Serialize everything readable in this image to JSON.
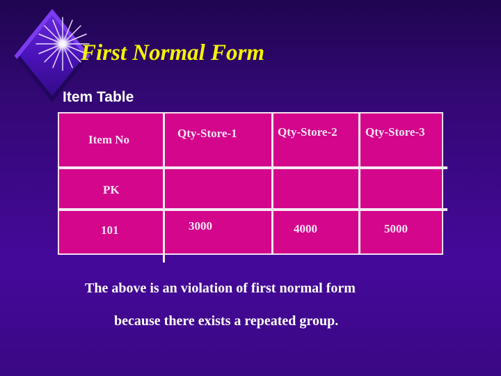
{
  "slide": {
    "title": "First Normal Form",
    "subtitle": "Item Table",
    "colors": {
      "title": "#f5f200",
      "table_fill": "#d4068b",
      "table_lines": "#f4eaf4",
      "background": "#3a0884"
    }
  },
  "table": {
    "headers": [
      "Item No",
      "Qty-Store-1",
      "Qty-Store-2",
      "Qty-Store-3"
    ],
    "rows": [
      [
        "PK",
        "",
        "",
        ""
      ],
      [
        "101",
        "3000",
        "4000",
        "5000"
      ]
    ]
  },
  "note": {
    "line1": "The above is an violation of first normal form",
    "line2": "because there exists a repeated group."
  },
  "decorations": {
    "logo_icons": [
      "diamond-icon",
      "star-burst-icon"
    ]
  }
}
